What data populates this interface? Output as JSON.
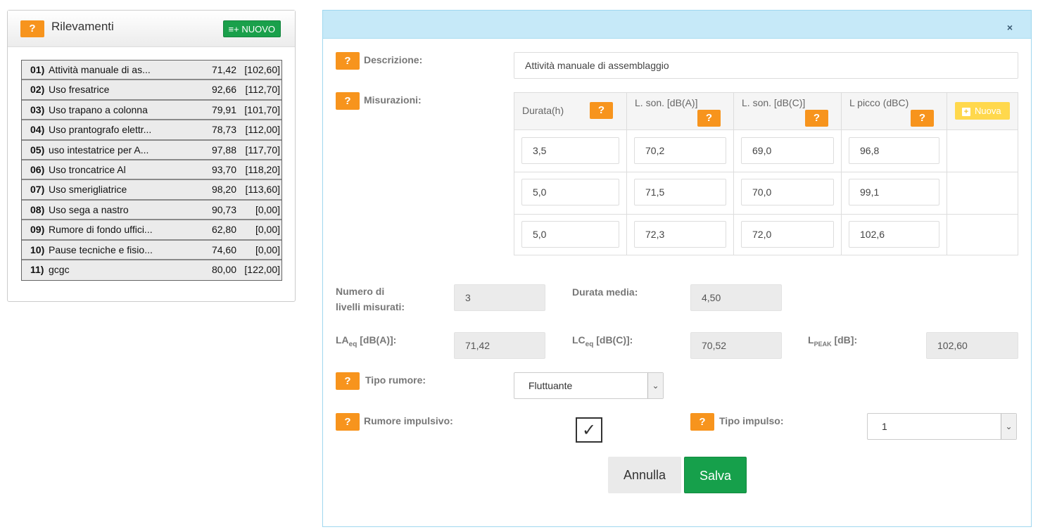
{
  "left_panel": {
    "title": "Rilevamenti",
    "help_label": "?",
    "new_button": "≡+ NUOVO",
    "items": [
      {
        "num": "01)",
        "name": "Attività manuale di as...",
        "value": "71,42",
        "max": "[102,60]"
      },
      {
        "num": "02)",
        "name": "Uso fresatrice",
        "value": "92,66",
        "max": "[112,70]"
      },
      {
        "num": "03)",
        "name": "Uso trapano a colonna",
        "value": "79,91",
        "max": "[101,70]"
      },
      {
        "num": "04)",
        "name": "Uso prantografo elettr...",
        "value": "78,73",
        "max": "[112,00]"
      },
      {
        "num": "05)",
        "name": "uso intestatrice per A...",
        "value": "97,88",
        "max": "[117,70]"
      },
      {
        "num": "06)",
        "name": "Uso troncatrice Al",
        "value": "93,70",
        "max": "[118,20]"
      },
      {
        "num": "07)",
        "name": "Uso smerigliatrice",
        "value": "98,20",
        "max": "[113,60]"
      },
      {
        "num": "08)",
        "name": "Uso sega a nastro",
        "value": "90,73",
        "max": "[0,00]"
      },
      {
        "num": "09)",
        "name": "Rumore di fondo uffici...",
        "value": "62,80",
        "max": "[0,00]"
      },
      {
        "num": "10)",
        "name": "Pause tecniche e fisio...",
        "value": "74,60",
        "max": "[0,00]"
      },
      {
        "num": "11)",
        "name": "gcgc",
        "value": "80,00",
        "max": "[122,00]"
      }
    ]
  },
  "modal": {
    "close": "×",
    "help_label": "?",
    "descrizione_label": "Descrizione:",
    "descrizione_value": "Attività manuale di assemblaggio",
    "misurazioni_label": "Misurazioni:",
    "table": {
      "headers": [
        "Durata(h)",
        "L. son. [dB(A)]",
        "L. son. [dB(C)]",
        "L picco (dBC)"
      ],
      "new_button": "Nuova",
      "rows": [
        [
          "3,5",
          "70,2",
          "69,0",
          "96,8"
        ],
        [
          "5,0",
          "71,5",
          "70,0",
          "99,1"
        ],
        [
          "5,0",
          "72,3",
          "72,0",
          "102,6"
        ]
      ]
    },
    "numero_label_1": "Numero di",
    "numero_label_2": "livelli misurati:",
    "numero_value": "3",
    "durata_media_label": "Durata media:",
    "durata_media_value": "4,50",
    "laeq_label_main": "LA",
    "laeq_label_sub": "eq",
    "laeq_label_unit": " [dB(A)]:",
    "laeq_value": "71,42",
    "lceq_label_main": "LC",
    "lceq_label_sub": "eq",
    "lceq_label_unit": " [dB(C)]:",
    "lceq_value": "70,52",
    "lpeak_label_main": "L",
    "lpeak_label_sub": "PEAK",
    "lpeak_label_unit": " [dB]:",
    "lpeak_value": "102,60",
    "tipo_rumore_label": "Tipo rumore:",
    "tipo_rumore_value": "Fluttuante",
    "rumore_impulsivo_label": "Rumore impulsivo:",
    "checkbox_mark": "✓",
    "tipo_impulso_label": "Tipo impulso:",
    "tipo_impulso_value": "1",
    "caret": "⌄",
    "cancel_button": "Annulla",
    "save_button": "Salva"
  },
  "colors": {
    "help": "#f7941d",
    "save": "#16a04b",
    "modal_header": "#c6e9f8",
    "nuova": "#ffd84d"
  }
}
